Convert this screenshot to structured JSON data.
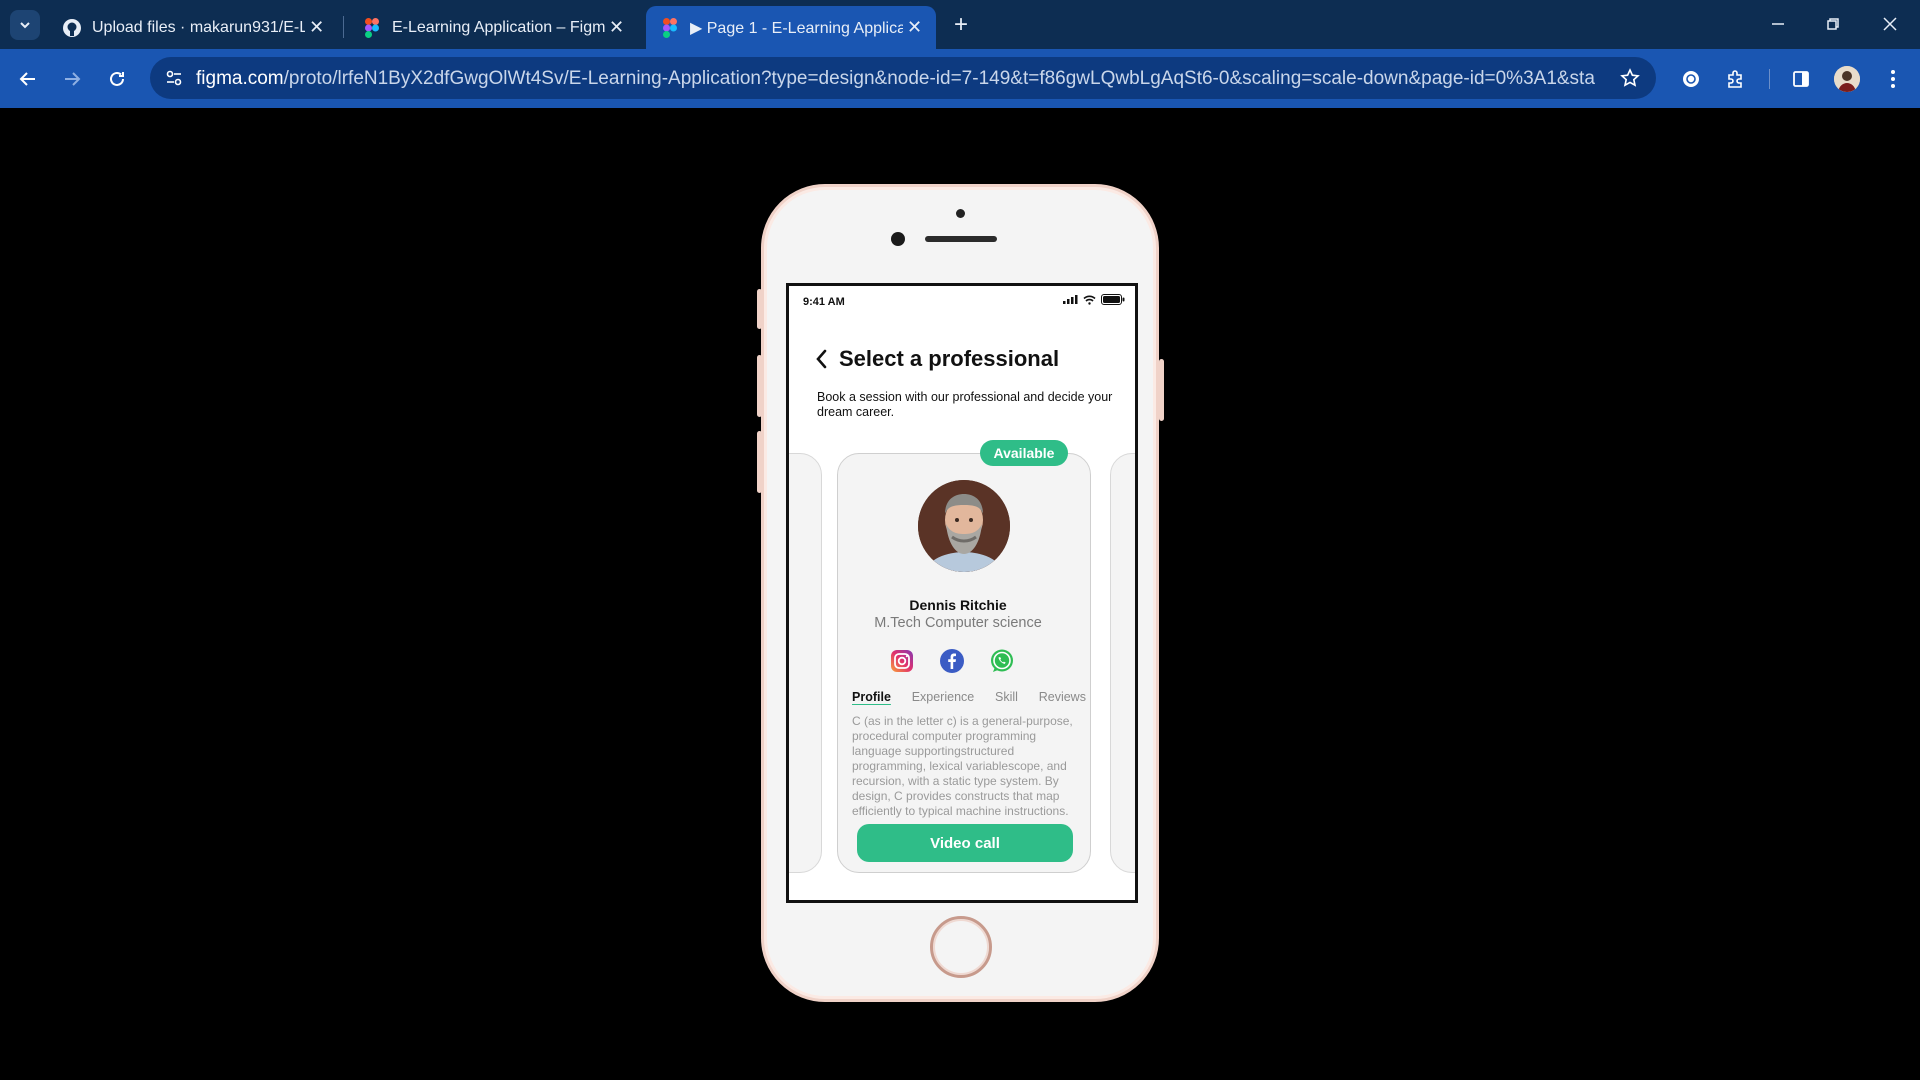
{
  "browser": {
    "tabs": [
      {
        "title": "Upload files · makarun931/E-Le",
        "favicon": "github-icon",
        "active": false
      },
      {
        "title": "E-Learning Application – Figma",
        "favicon": "figma-icon",
        "active": false
      },
      {
        "title": "▶ Page 1 - E-Learning Applicati",
        "favicon": "figma-icon",
        "active": true
      }
    ],
    "url_host": "figma.com",
    "url_path": "/proto/lrfeN1ByX2dfGwgOlWt4Sv/E-Learning-Application?type=design&node-id=7-149&t=f86gwLQwbLgAqSt6-0&scaling=scale-down&page-id=0%3A1&starting-point...",
    "accent": "#1a56b2",
    "tabbar_color": "#0d2d52"
  },
  "status": {
    "time": "9:41 AM"
  },
  "header": {
    "title": "Select a professional",
    "subtitle": "Book  a session with our professional and decide your dream career."
  },
  "card": {
    "badge": "Available",
    "name": "Dennis Ritchie",
    "degree": "M.Tech Computer science",
    "social": [
      "instagram-icon",
      "facebook-icon",
      "whatsapp-icon"
    ],
    "tabs": [
      "Profile",
      "Experience",
      "Skill",
      "Reviews"
    ],
    "active_tab": "Profile",
    "about": "C (as in the letter c) is a general-purpose, procedural computer programming language supportingstructured programming, lexical variablescope, and recursion, with a static type system. By design, C provides constructs that map efficiently to typical machine instructions.",
    "cta": "Video call",
    "accent": "#2fbd88"
  }
}
